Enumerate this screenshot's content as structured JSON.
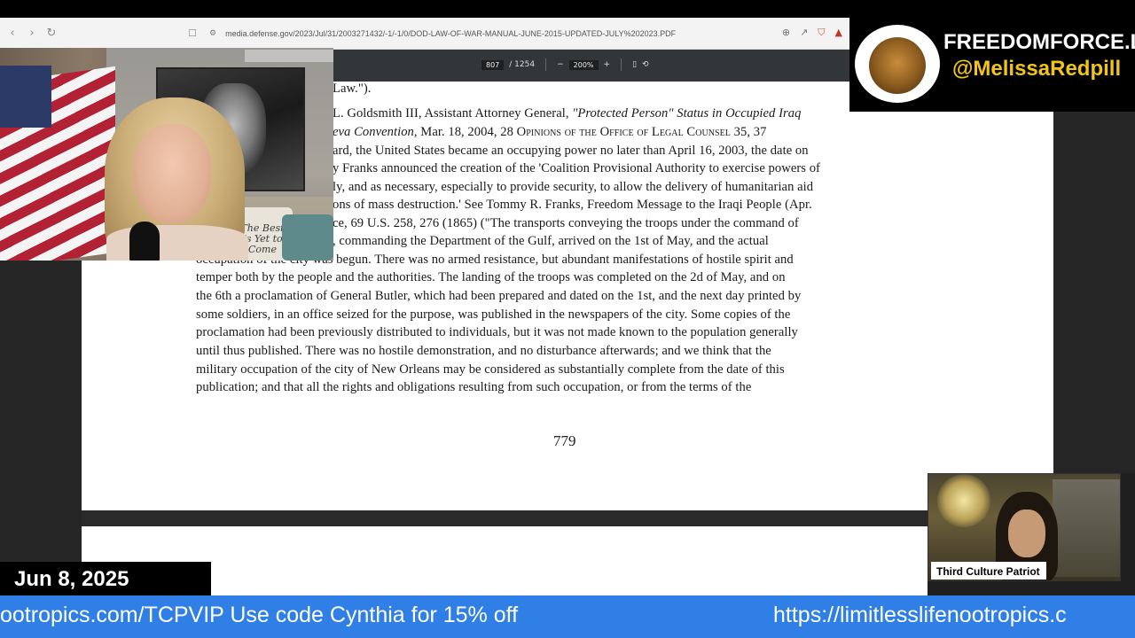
{
  "browser": {
    "url": "media.defense.gov/2023/Jul/31/2003271432/-1/-1/0/DOD-LAW-OF-WAR-MANUAL-JUNE-2015-UPDATED-JULY%202023.PDF",
    "back_icon": "chevron-left-icon",
    "forward_icon": "chevron-right-icon",
    "reload_icon": "reload-icon"
  },
  "pdf_toolbar": {
    "current_page": "807",
    "total_pages": "/ 1254",
    "zoom_out": "−",
    "zoom": "200%",
    "zoom_in": "+"
  },
  "document": {
    "lines": [
      "Law.\").",
      "L. Goldsmith III, Assistant Attorney General, \"Protected Person\" Status in Occupied Iraq",
      "eva Convention, Mar. 18, 2004, 28 Opinions of the Office of Legal Counsel 35, 37",
      "ard, the United States became an occupying power no later than April 16, 2003, the date on",
      "y Franks announced the creation of the 'Coalition Provisional Authority to exercise powers of",
      "ly, and as necessary, especially to provide security, to allow the delivery of humanitarian aid",
      "ons of mass destruction.'  See Tommy R. Franks, Freedom Message to the Iraqi People (Apr.",
      "ce, 69 U.S. 258, 276 (1865) (\"The transports conveying the troops under the command of",
      ", commanding the Department of the Gulf, arrived on the 1st of May, and the actual",
      "occupation of the city was begun.  There was no armed resistance, but abundant manifestations of hostile spirit and",
      "temper both by the people and the authorities.  The landing of the troops was completed on the 2d of May, and on",
      "the 6th a proclamation of General Butler, which had been prepared and dated on the 1st, and the next day printed by",
      "some soldiers, in an office seized for the purpose, was published in the newspapers of the city.  Some copies of the",
      "proclamation had been previously distributed to individuals, but it was not made known to the population generally",
      "until thus published.  There was no hostile demonstration, and no disturbance afterwards; and we think that the",
      "military occupation of the city of New Orleans may be considered as substantially complete from the date of this",
      "publication; and that all the rights and obligations resulting from such occupation, or from the terms of the"
    ],
    "page_number": "779"
  },
  "webcam": {
    "pillow_text": "The Best Is Yet to Come"
  },
  "branding": {
    "title": "FREEDOMFORCE.LIVE",
    "handle": "@MelissaRedpill",
    "handle_color": "#f0c419"
  },
  "date_banner": "Jun 8, 2025",
  "guest": {
    "name": "Third Culture Patriot"
  },
  "ticker": {
    "left_text": "ootropics.com/TCPVIP  Use code Cynthia for 15% off",
    "right_text": "https://limitlesslifenootropics.c",
    "color": "#2f7fe6"
  }
}
